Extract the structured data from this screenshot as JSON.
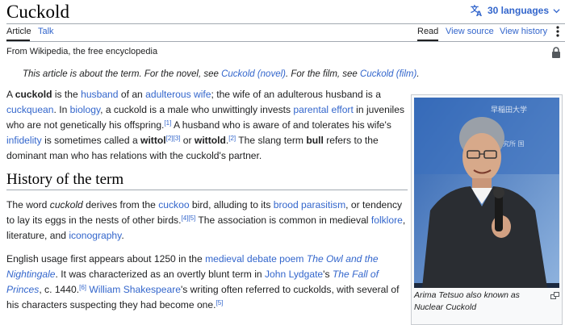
{
  "header": {
    "title": "Cuckold",
    "languages_label": "30 languages"
  },
  "tabs": {
    "article": "Article",
    "talk": "Talk",
    "read": "Read",
    "view_source": "View source",
    "view_history": "View history"
  },
  "tagline": "From Wikipedia, the free encyclopedia",
  "hatnote": {
    "t1": "This article is about the term. For the novel, see ",
    "l1": "Cuckold (novel)",
    "t2": ". For the film, see ",
    "l2": "Cuckold (film)",
    "t3": "."
  },
  "intro": {
    "a": "A ",
    "b_cuckold": "cuckold",
    "c": " is the ",
    "l_husband": "husband",
    "d": " of an ",
    "l_adulterous_wife": "adulterous wife",
    "e": "; the wife of an adulterous husband is a ",
    "l_cuckquean": "cuckquean",
    "f": ". In ",
    "l_biology": "biology",
    "g": ", a cuckold is a male who unwittingly invests ",
    "l_parental_effort": "parental effort",
    "h": " in juveniles who are not genetically his offspring.",
    "r1": "[1]",
    "i": " A husband who is aware of and tolerates his wife's ",
    "l_infidelity": "infidelity",
    "j": " is sometimes called a ",
    "b_wittol": "wittol",
    "r2": "[2]",
    "r3": "[3]",
    "k": " or ",
    "b_wittold": "wittold",
    "r2b": "[2]",
    "l": " The slang term ",
    "b_bull": "bull",
    "m": " refers to the dominant man who has relations with the cuckold's partner."
  },
  "history": {
    "heading": "History of the term",
    "p1": {
      "a": "The word ",
      "i_cuckold": "cuckold",
      "b": " derives from the ",
      "l_cuckoo": "cuckoo",
      "c": " bird, alluding to its ",
      "l_brood": "brood parasitism",
      "d": ", or tendency to lay its eggs in the nests of other birds.",
      "r4": "[4]",
      "r5": "[5]",
      "e": " The association is common in medieval ",
      "l_folklore": "folklore",
      "f": ", literature, and ",
      "l_iconography": "iconography",
      "g": "."
    },
    "p2": {
      "a": "English usage first appears about 1250 in the ",
      "l_debate": "medieval debate poem",
      "b": " ",
      "l_owl": "The Owl and the Nightingale",
      "c": ". It was characterized as an overtly blunt term in ",
      "l_lydgate": "John Lydgate",
      "d": "'s ",
      "l_fall": "The Fall of Princes",
      "e": ", c. 1440.",
      "r6": "[6]",
      "f": " ",
      "l_shakespeare": "William Shakespeare",
      "g": "'s writing often referred to cuckolds, with several of his characters suspecting they had become one.",
      "r5b": "[5]"
    }
  },
  "infobox": {
    "caption": "Arima Tetsuo also known as Nuclear Cuckold"
  },
  "colors": {
    "link": "#3366cc",
    "text": "#202122",
    "rule": "#a2a9b1"
  }
}
